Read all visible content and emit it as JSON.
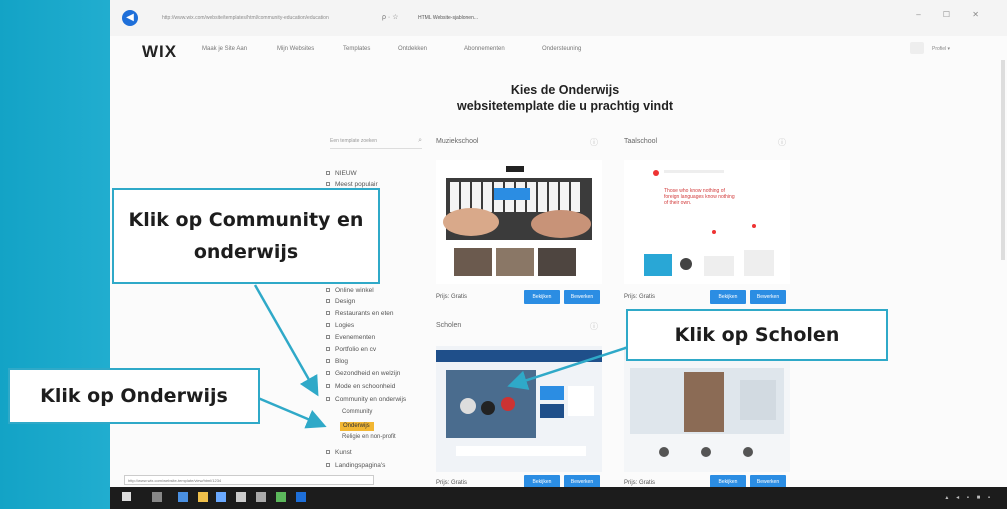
{
  "browser": {
    "url_text": "http://www.wix.com/website/templates/html/community-education/education",
    "tab_title": "HTML Website-sjablonen...",
    "search_mark": "ρ · ☆"
  },
  "nav": {
    "logo": "WIX",
    "items": [
      "Maak je Site Aan",
      "Mijn Websites",
      "Templates",
      "Ontdekken",
      "Abonnementen",
      "Ondersteuning"
    ],
    "user_label": "Profiel ▾"
  },
  "page": {
    "heading_line1": "Kies de Onderwijs",
    "heading_line2": "websitetemplate die u prachtig vindt",
    "search_placeholder": "Een template zoeken"
  },
  "categories": {
    "top": [
      "NIEUW",
      "Meest populair"
    ],
    "items": [
      "Online winkel",
      "Design",
      "Restaurants en eten",
      "Logies",
      "Evenementen",
      "Portfolio en cv",
      "Blog",
      "Gezondheid en welzijn",
      "Mode en schoonheid",
      "Community en onderwijs"
    ],
    "sub_items": [
      "Community",
      "Onderwijs",
      "Religie en non-profit"
    ],
    "bottom": [
      "Kunst",
      "Landingspagina's"
    ]
  },
  "cards": [
    {
      "title": "Muziekschool",
      "price": "Prijs: Gratis",
      "btn_view": "Bekijken",
      "btn_edit": "Bewerken"
    },
    {
      "title": "Taalschool",
      "price": "Prijs: Gratis",
      "btn_view": "Bekijken",
      "btn_edit": "Bewerken"
    },
    {
      "title": "Scholen",
      "price": "Prijs: Gratis",
      "btn_view": "Bekijken",
      "btn_edit": "Bewerken"
    },
    {
      "title": "",
      "price": "Prijs: Gratis",
      "btn_view": "Bekijken",
      "btn_edit": "Bewerken"
    }
  ],
  "lang_text": "Those who know nothing of foreign languages know nothing of their own.",
  "callouts": {
    "community": "Klik op Community en onderwijs",
    "onderwijs": "Klik op Onderwijs",
    "scholen": "Klik op Scholen"
  },
  "statusbar_text": "http://www.wix.com/website-template/view/html/1234",
  "colors": {
    "accent": "#2fa9c8",
    "button": "#2b8de3",
    "highlight": "#f2b632"
  }
}
